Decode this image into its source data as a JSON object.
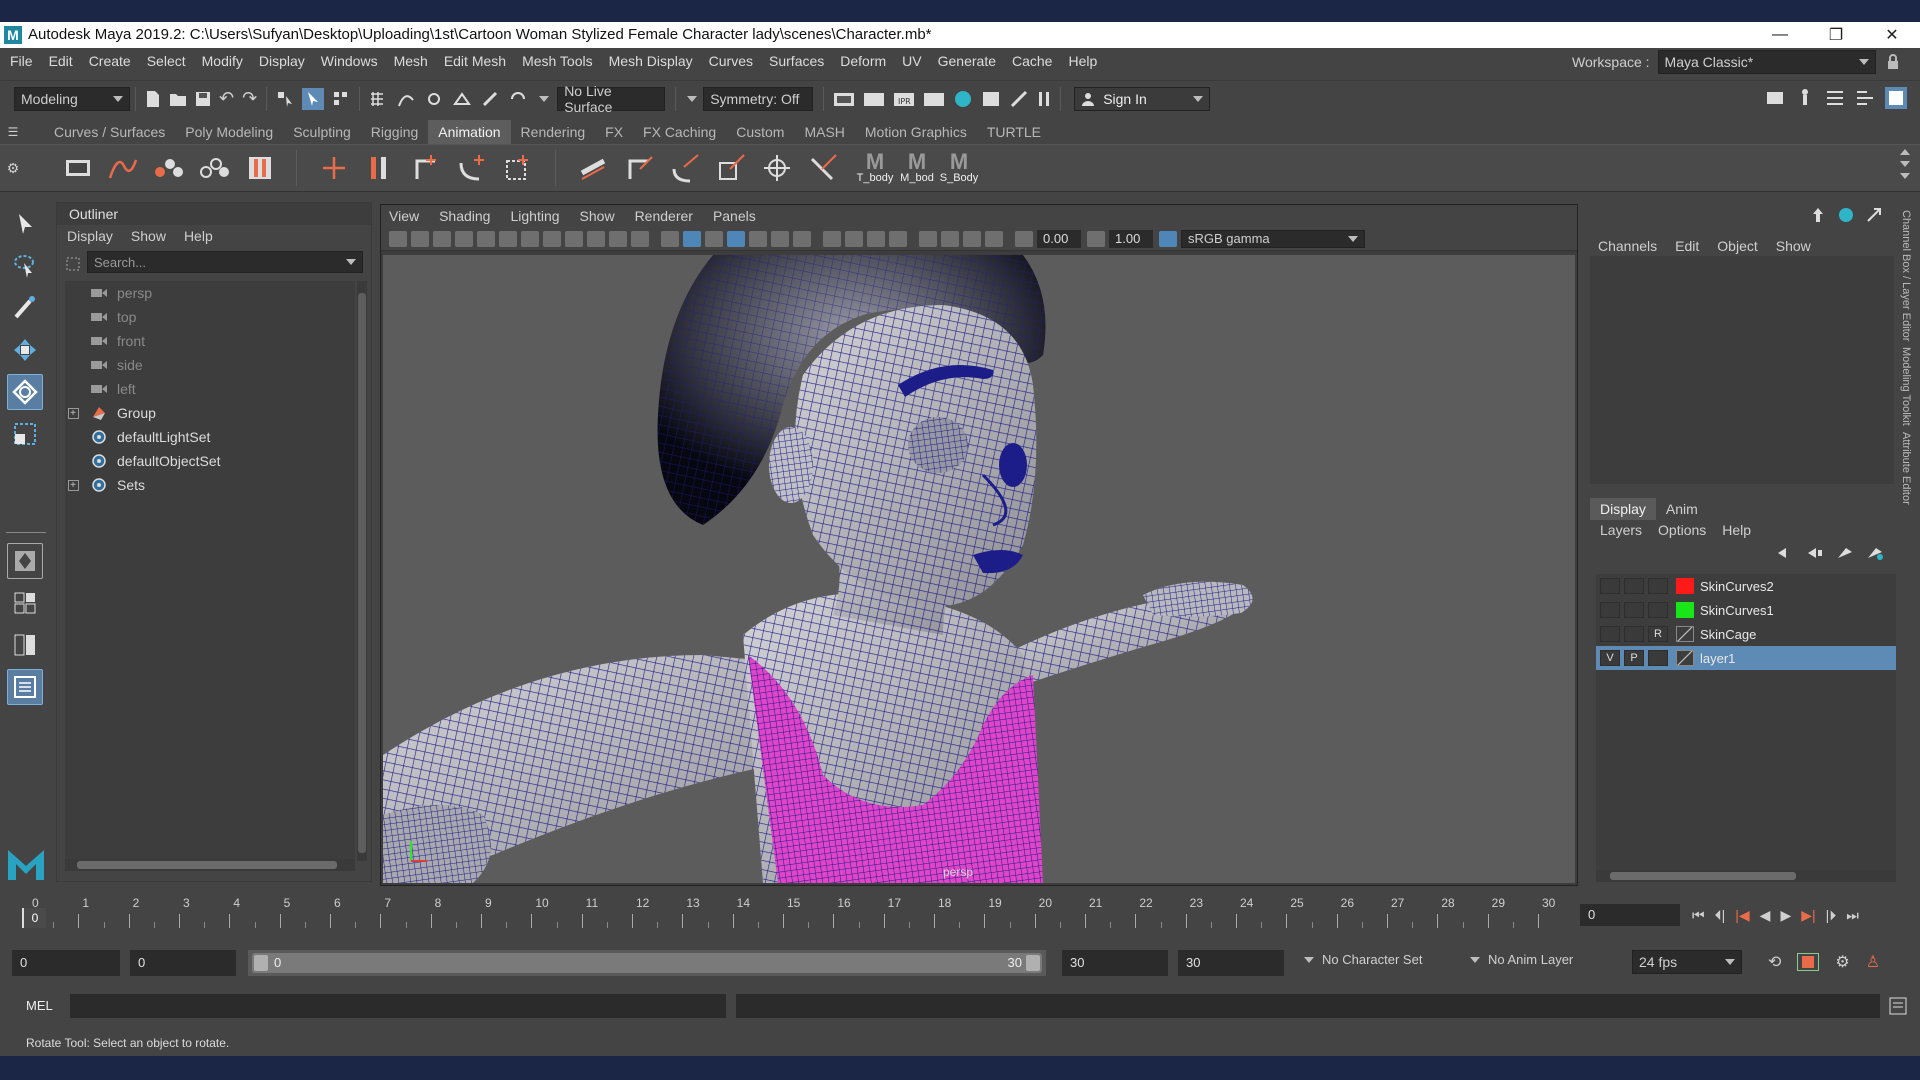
{
  "app": {
    "title": "Autodesk Maya 2019.2: C:\\Users\\Sufyan\\Desktop\\Uploading\\1st\\Cartoon Woman Stylized Female Character lady\\scenes\\Character.mb*",
    "logo_letter": "M",
    "window_controls": {
      "minimize": "—",
      "restore": "❐",
      "close": "✕"
    }
  },
  "menubar": {
    "items": [
      "File",
      "Edit",
      "Create",
      "Select",
      "Modify",
      "Display",
      "Windows",
      "Mesh",
      "Edit Mesh",
      "Mesh Tools",
      "Mesh Display",
      "Curves",
      "Surfaces",
      "Deform",
      "UV",
      "Generate",
      "Cache",
      "Help"
    ],
    "workspace_label": "Workspace :",
    "workspace_value": "Maya Classic*"
  },
  "statusline": {
    "mode": "Modeling",
    "live_surface": "No Live Surface",
    "symmetry": "Symmetry: Off",
    "sign_in": "Sign In"
  },
  "shelf": {
    "tabs": [
      "Curves / Surfaces",
      "Poly Modeling",
      "Sculpting",
      "Rigging",
      "Animation",
      "Rendering",
      "FX",
      "FX Caching",
      "Custom",
      "MASH",
      "Motion Graphics",
      "TURTLE"
    ],
    "active_tab": "Animation",
    "custom_buttons": [
      "T_body",
      "M_bod",
      "S_Body"
    ]
  },
  "outliner": {
    "title": "Outliner",
    "menus": [
      "Display",
      "Show",
      "Help"
    ],
    "search_placeholder": "Search...",
    "nodes": [
      {
        "label": "persp",
        "type": "camera",
        "dim": true,
        "expandable": false
      },
      {
        "label": "top",
        "type": "camera",
        "dim": true,
        "expandable": false
      },
      {
        "label": "front",
        "type": "camera",
        "dim": true,
        "expandable": false
      },
      {
        "label": "side",
        "type": "camera",
        "dim": true,
        "expandable": false
      },
      {
        "label": "left",
        "type": "camera",
        "dim": true,
        "expandable": false
      },
      {
        "label": "Group",
        "type": "group",
        "dim": false,
        "expandable": true
      },
      {
        "label": "defaultLightSet",
        "type": "set",
        "dim": false,
        "expandable": false
      },
      {
        "label": "defaultObjectSet",
        "type": "set",
        "dim": false,
        "expandable": false
      },
      {
        "label": "Sets",
        "type": "set",
        "dim": false,
        "expandable": true
      }
    ]
  },
  "viewport": {
    "menus": [
      "View",
      "Shading",
      "Lighting",
      "Show",
      "Renderer",
      "Panels"
    ],
    "exposure": "0.00",
    "gamma": "1.00",
    "color_space": "sRGB gamma",
    "camera_label": "persp"
  },
  "channelbox": {
    "menus": [
      "Channels",
      "Edit",
      "Object",
      "Show"
    ]
  },
  "layer_editor": {
    "tabs": [
      "Display",
      "Anim"
    ],
    "active_tab": "Display",
    "menus": [
      "Layers",
      "Options",
      "Help"
    ],
    "layers": [
      {
        "name": "SkinCurves2",
        "v": "",
        "p": "",
        "r": "",
        "color": "#ff1a1a",
        "selected": false
      },
      {
        "name": "SkinCurves1",
        "v": "",
        "p": "",
        "r": "",
        "color": "#19e619",
        "selected": false
      },
      {
        "name": "SkinCage",
        "v": "",
        "p": "",
        "r": "R",
        "color": "",
        "selected": false
      },
      {
        "name": "layer1",
        "v": "V",
        "p": "P",
        "r": "",
        "color": "",
        "selected": true
      }
    ]
  },
  "side_tabs": [
    "Channel Box / Layer Editor",
    "Modeling Toolkit",
    "Attribute Editor"
  ],
  "timeslider": {
    "ticks": [
      "0",
      "1",
      "2",
      "3",
      "4",
      "5",
      "6",
      "7",
      "8",
      "9",
      "10",
      "11",
      "12",
      "13",
      "14",
      "15",
      "16",
      "17",
      "18",
      "19",
      "20",
      "21",
      "22",
      "23",
      "24",
      "25",
      "26",
      "27",
      "28",
      "29",
      "30"
    ],
    "current_frame": "0",
    "current_frame_field": "0"
  },
  "rangeslider": {
    "start": "0",
    "playback_start": "0",
    "range_start_label": "0",
    "range_end_label": "30",
    "playback_end": "30",
    "end": "30",
    "character_set": "No Character Set",
    "anim_layer": "No Anim Layer",
    "fps": "24 fps"
  },
  "commandline": {
    "label": "MEL"
  },
  "helpline": {
    "text": "Rotate Tool: Select an object to rotate."
  },
  "colors": {
    "ui_bg": "#444444",
    "accent": "#5d8bb5",
    "wire": "#1d1d8a",
    "swimsuit": "#e044c8"
  }
}
